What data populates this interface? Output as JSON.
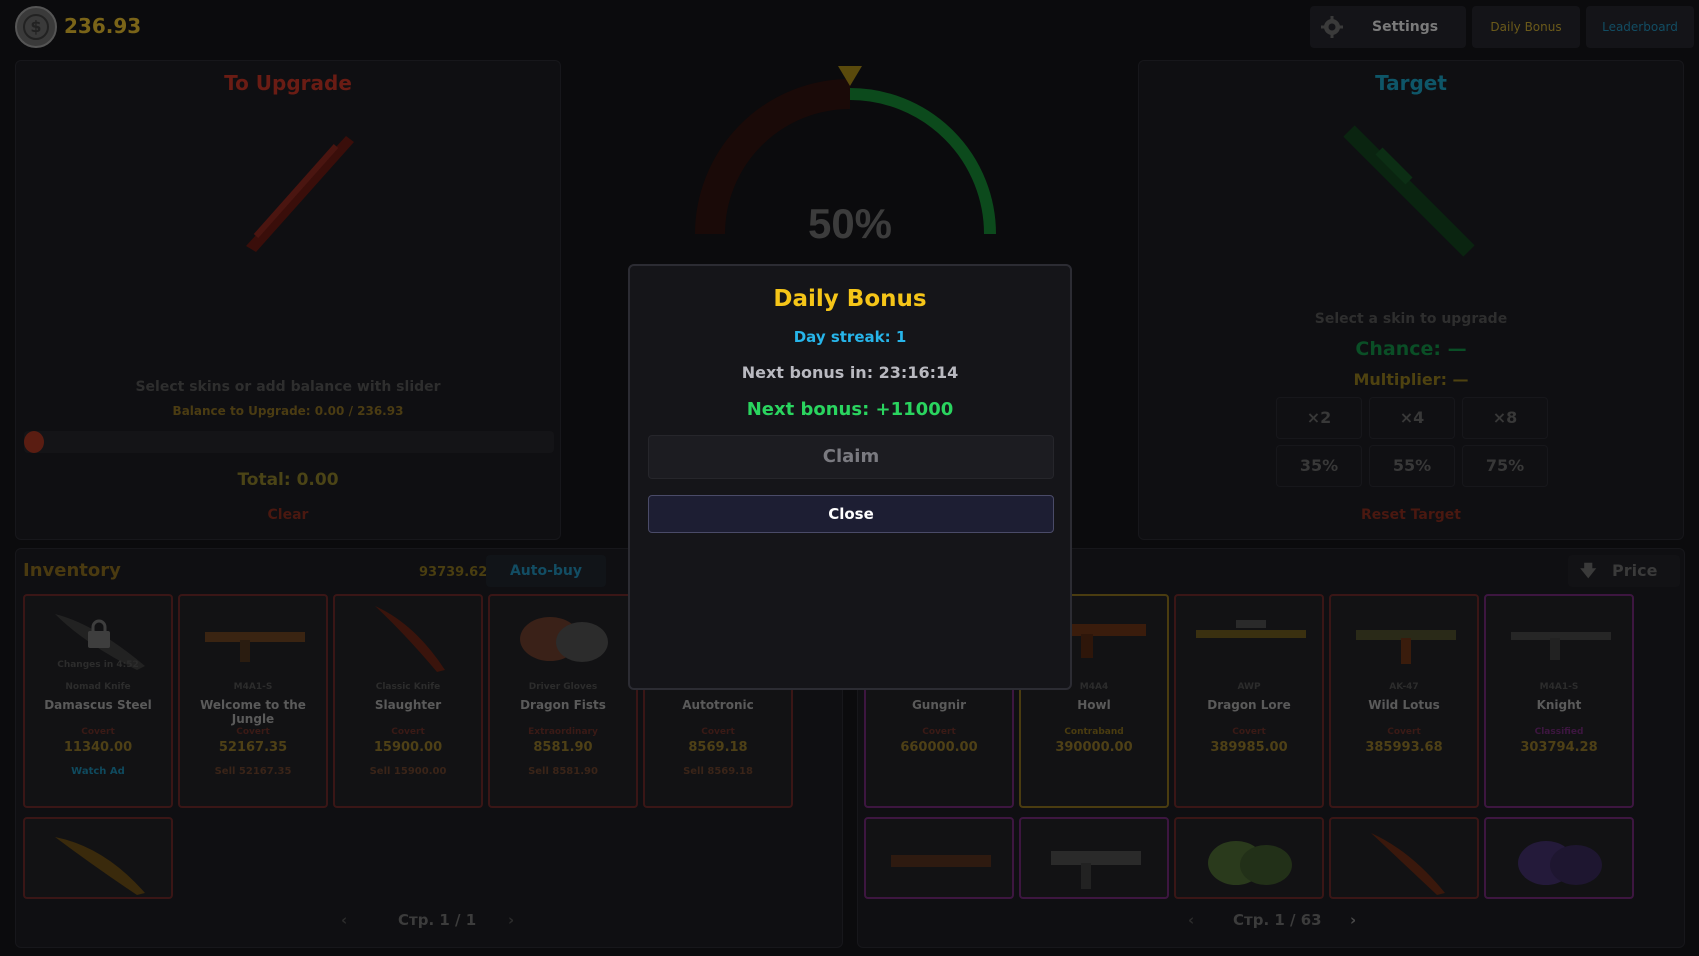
{
  "header": {
    "balance": "236.93",
    "settings_label": "Settings",
    "daily_bonus_label": "Daily Bonus",
    "leaderboard_label": "Leaderboard"
  },
  "upgrade": {
    "title": "To Upgrade",
    "hint": "Select skins or add balance with slider",
    "balance_line": "Balance to Upgrade: 0.00 / 236.93",
    "total": "Total: 0.00",
    "clear": "Clear",
    "slider_value": 0
  },
  "gauge": {
    "chance_text": "50%",
    "chance_fraction": 0.5
  },
  "target": {
    "title": "Target",
    "hint": "Select a skin to upgrade",
    "chance": "Chance: —",
    "multiplier": "Multiplier: —",
    "multipliers": [
      "×2",
      "×4",
      "×8"
    ],
    "chances": [
      "35%",
      "55%",
      "75%"
    ],
    "reset": "Reset Target"
  },
  "inventory": {
    "title": "Inventory",
    "value": "93739.62",
    "autobuy": "Auto-buy",
    "page": "Стр. 1 / 1",
    "cards": [
      {
        "type": "Nomad Knife",
        "name": "Damascus Steel",
        "rarity": "Covert",
        "price": "11340.00",
        "action": "Watch Ad",
        "lock": "Changes in 4:52"
      },
      {
        "type": "M4A1-S",
        "name": "Welcome to the Jungle",
        "rarity": "Covert",
        "price": "52167.35",
        "action": "Sell 52167.35"
      },
      {
        "type": "Classic Knife",
        "name": "Slaughter",
        "rarity": "Covert",
        "price": "15900.00",
        "action": "Sell 15900.00"
      },
      {
        "type": "Driver Gloves",
        "name": "Dragon Fists",
        "rarity": "Extraordinary",
        "price": "8581.90",
        "action": "Sell 8581.90"
      },
      {
        "type": "",
        "name": "Autotronic",
        "rarity": "Covert",
        "price": "8569.18",
        "action": "Sell 8569.18"
      }
    ]
  },
  "shop": {
    "sort_label": "Price",
    "page": "Стр. 1 / 63",
    "cards": [
      {
        "type": "",
        "name": "Gungnir",
        "rarity": "Covert",
        "price": "660000.00"
      },
      {
        "type": "M4A4",
        "name": "Howl",
        "rarity": "Contraband",
        "price": "390000.00"
      },
      {
        "type": "AWP",
        "name": "Dragon Lore",
        "rarity": "Covert",
        "price": "389985.00"
      },
      {
        "type": "AK-47",
        "name": "Wild Lotus",
        "rarity": "Covert",
        "price": "385993.68"
      },
      {
        "type": "M4A1-S",
        "name": "Knight",
        "rarity": "Classified",
        "price": "303794.28"
      }
    ]
  },
  "modal": {
    "title": "Daily Bonus",
    "streak": "Day streak: 1",
    "next_in": "Next bonus in: 23:16:14",
    "next_amount": "Next bonus: +11000",
    "claim": "Claim",
    "close": "Close"
  }
}
